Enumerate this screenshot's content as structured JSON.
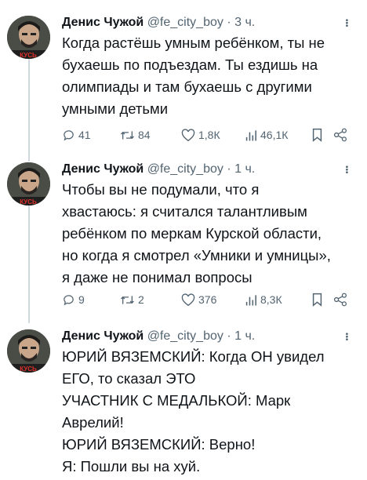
{
  "tweets": [
    {
      "name": "Денис Чужой",
      "handle": "@fe_city_boy",
      "separator": "·",
      "time": "3 ч.",
      "text": "Когда растёшь умным ребёнком, ты не\nбухаешь по подъездам. Ты ездишь на\nолимпиады и там бухаешь с другими\nумными детьми",
      "replies": "41",
      "retweets": "84",
      "likes": "1,8К",
      "views": "46,1К",
      "avatar_caption": "КУСЬ"
    },
    {
      "name": "Денис Чужой",
      "handle": "@fe_city_boy",
      "separator": "·",
      "time": "1 ч.",
      "text": "Чтобы вы не подумали, что я\nхвастаюсь: я считался талантливым\nребёнком по меркам Курской области,\nно когда я смотрел «Умники и умницы»,\nя даже не понимал вопросы",
      "replies": "9",
      "retweets": "2",
      "likes": "376",
      "views": "8,3К",
      "avatar_caption": "КУСЬ"
    },
    {
      "name": "Денис Чужой",
      "handle": "@fe_city_boy",
      "separator": "·",
      "time": "1 ч.",
      "text": "ЮРИЙ ВЯЗЕМСКИЙ: Когда ОН увидел\nЕГО, то сказал ЭТО\nУЧАСТНИК С МЕДАЛЬКОЙ: Марк\nАврелий!\nЮРИЙ ВЯЗЕМСКИЙ: Верно!\nЯ: Пошли вы на хуй.",
      "avatar_caption": "КУСЬ"
    }
  ],
  "icons": {
    "reply": "reply-icon",
    "retweet": "retweet-icon",
    "like": "heart-icon",
    "views": "views-icon",
    "bookmark": "bookmark-icon",
    "share": "share-icon",
    "more": "more-icon"
  },
  "colors": {
    "text": "#0f1419",
    "secondary": "#536471",
    "thread_line": "#cfd9de",
    "background": "#ffffff"
  }
}
